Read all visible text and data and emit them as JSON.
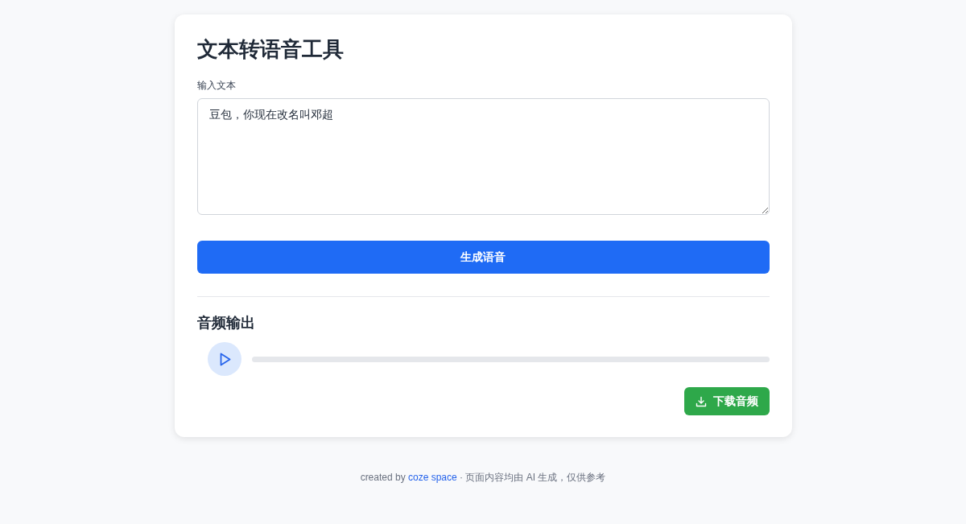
{
  "title": "文本转语音工具",
  "input": {
    "label": "输入文本",
    "value": "豆包，你现在改名叫邓超"
  },
  "generate_button": "生成语音",
  "audio": {
    "heading": "音频输出",
    "playing": false,
    "level": 0
  },
  "download_button": "下载音频",
  "footer": {
    "prefix": "created by ",
    "link": "coze space",
    "suffix": " · 页面内容均由 AI 生成，仅供参考"
  }
}
